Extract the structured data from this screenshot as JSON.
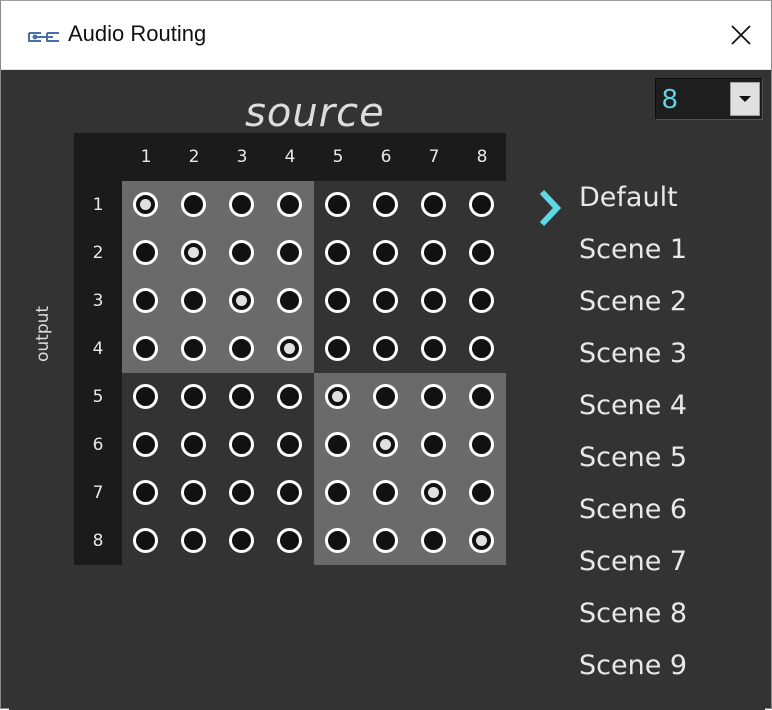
{
  "window": {
    "title": "Audio Routing",
    "app_icon": "audio-routing-app-icon",
    "close_icon": "close-icon",
    "close_glyph": "✕"
  },
  "channel_select": {
    "value": "8",
    "arrow_icon": "chevron-down-icon"
  },
  "matrix": {
    "source_label": "source",
    "output_label": "output",
    "columns": [
      "1",
      "2",
      "3",
      "4",
      "5",
      "6",
      "7",
      "8"
    ],
    "rows": [
      "1",
      "2",
      "3",
      "4",
      "5",
      "6",
      "7",
      "8"
    ],
    "active": [
      [
        1,
        1
      ],
      [
        2,
        2
      ],
      [
        3,
        3
      ],
      [
        4,
        4
      ],
      [
        5,
        5
      ],
      [
        6,
        6
      ],
      [
        7,
        7
      ],
      [
        8,
        8
      ]
    ]
  },
  "scenes": {
    "selected_index": 0,
    "selector_icon": "chevron-right-icon",
    "items": [
      "Default",
      "Scene 1",
      "Scene 2",
      "Scene 3",
      "Scene 4",
      "Scene 5",
      "Scene 6",
      "Scene 7",
      "Scene 8",
      "Scene 9"
    ]
  },
  "colors": {
    "accent": "#5fd7e6",
    "background": "#333333",
    "matrix_header": "#1b1b1b",
    "quad_light": "#6a6a6a"
  }
}
